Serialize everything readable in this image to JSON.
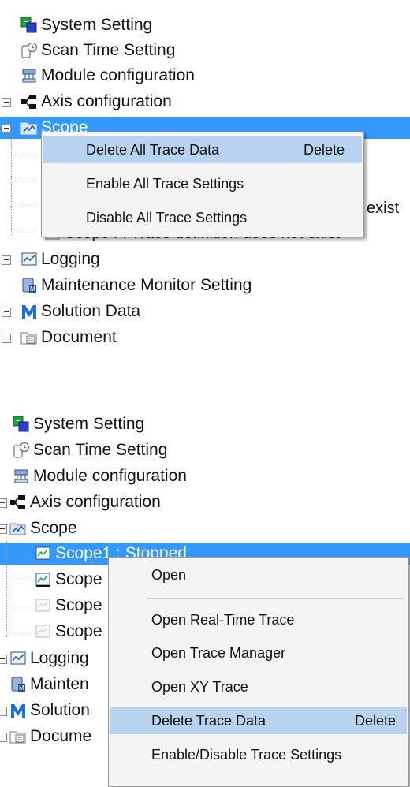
{
  "panel_top": {
    "tree": {
      "system_setting": "System Setting",
      "scan_time_setting": "Scan Time Setting",
      "module_configuration": "Module configuration",
      "axis_configuration": "Axis configuration",
      "scope": "Scope",
      "hidden_row_tail_1": "exist",
      "hidden_row_tail_2": "Scope4 : Trace definition does not exist",
      "logging": "Logging",
      "maintenance_monitor_setting": "Maintenance Monitor Setting",
      "solution_data": "Solution Data",
      "document": "Document"
    },
    "context_menu": {
      "items": [
        {
          "label": "Delete All Trace Data",
          "accelerator": "Delete"
        },
        {
          "label": "Enable All Trace Settings"
        },
        {
          "label": "Disable All Trace Settings"
        }
      ]
    }
  },
  "panel_bottom": {
    "tree": {
      "system_setting": "System Setting",
      "scan_time_setting": "Scan Time Setting",
      "module_configuration": "Module configuration",
      "axis_configuration": "Axis configuration",
      "scope": "Scope",
      "scope1": "Scope1 : Stopped",
      "scope2": "Scope",
      "scope3": "Scope",
      "scope4": "Scope",
      "logging": "Logging",
      "maintenance": "Mainten",
      "solution": "Solution",
      "document": "Docume"
    },
    "context_menu": {
      "items": [
        {
          "label": "Open"
        },
        {
          "label": "Open Real-Time Trace"
        },
        {
          "label": "Open Trace Manager"
        },
        {
          "label": "Open XY Trace"
        },
        {
          "label": "Delete Trace Data",
          "accelerator": "Delete"
        },
        {
          "label": "Enable/Disable Trace Settings"
        }
      ]
    }
  },
  "colors": {
    "selection": "#3399ff",
    "menu_highlight": "#b7d3ef",
    "menu_background": "#f4f4f4"
  }
}
